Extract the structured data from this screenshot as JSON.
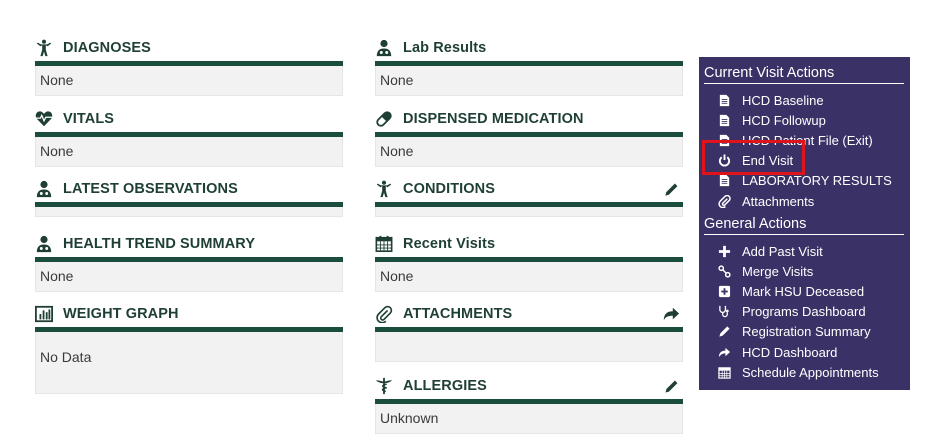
{
  "left_widgets": [
    {
      "title": "DIAGNOSES",
      "body": "None",
      "icon": "person-arms-up-icon"
    },
    {
      "title": "VITALS",
      "body": "None",
      "icon": "heart-pulse-icon"
    },
    {
      "title": "LATEST OBSERVATIONS",
      "body": "",
      "icon": "doctor-icon"
    },
    {
      "title": "HEALTH TREND SUMMARY",
      "body": "None",
      "icon": "doctor-icon"
    },
    {
      "title": "WEIGHT GRAPH",
      "body": "No Data",
      "icon": "bar-chart-icon"
    }
  ],
  "right_widgets": [
    {
      "title": "Lab Results",
      "body": "None",
      "icon": "doctor-icon"
    },
    {
      "title": "DISPENSED MEDICATION",
      "body": "None",
      "icon": "pill-icon"
    },
    {
      "title": "CONDITIONS",
      "body": "",
      "icon": "person-arms-up-icon",
      "action": "pencil-icon"
    },
    {
      "title": "Recent Visits",
      "body": "None",
      "icon": "calendar-icon"
    },
    {
      "title": "ATTACHMENTS",
      "body": "",
      "icon": "paperclip-icon",
      "action": "share-arrow-icon"
    },
    {
      "title": "ALLERGIES",
      "body": "Unknown",
      "icon": "caduceus-icon",
      "action": "pencil-icon"
    }
  ],
  "panel": {
    "current_title": "Current Visit Actions",
    "current_items": [
      {
        "label": "HCD Baseline",
        "icon": "document-icon"
      },
      {
        "label": "HCD Followup",
        "icon": "document-icon"
      },
      {
        "label": "HCD Patient File (Exit)",
        "icon": "document-icon"
      },
      {
        "label": "End Visit",
        "icon": "power-icon"
      },
      {
        "label": "LABORATORY RESULTS",
        "icon": "document-icon"
      },
      {
        "label": "Attachments",
        "icon": "paperclip-icon"
      }
    ],
    "general_title": "General Actions",
    "general_items": [
      {
        "label": "Add Past Visit",
        "icon": "plus-icon"
      },
      {
        "label": "Merge Visits",
        "icon": "merge-icon"
      },
      {
        "label": "Mark HSU Deceased",
        "icon": "plus-square-icon"
      },
      {
        "label": "Programs Dashboard",
        "icon": "stethoscope-icon"
      },
      {
        "label": "Registration Summary",
        "icon": "pencil-icon"
      },
      {
        "label": "HCD Dashboard",
        "icon": "share-arrow-icon"
      },
      {
        "label": "Schedule Appointments",
        "icon": "calendar-icon"
      }
    ]
  },
  "colors": {
    "accent": "#1b4d3e",
    "panel": "#3a3266",
    "highlight": "#e0131a"
  }
}
